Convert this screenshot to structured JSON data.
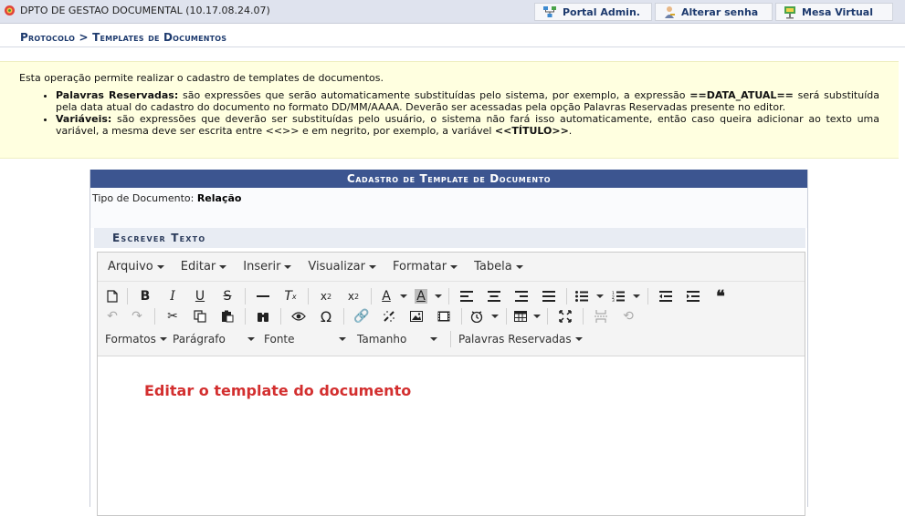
{
  "topbar": {
    "unit": "DPTO DE GESTAO DOCUMENTAL (10.17.08.24.07)",
    "buttons": {
      "portal": "Portal Admin.",
      "senha": "Alterar senha",
      "mesa": "Mesa Virtual"
    }
  },
  "breadcrumb": "Protocolo > Templates de Documentos",
  "info": {
    "intro": "Esta operação permite realizar o cadastro de templates de documentos.",
    "items": [
      {
        "term": "Palavras Reservadas:",
        "text_a": " são expressões que serão automaticamente substituídas pelo sistema, por exemplo, a expressão ",
        "code": "==DATA_ATUAL==",
        "text_b": " será substituída pela data atual do cadastro do documento no formato DD/MM/AAAA. Deverão ser acessadas pela opção Palavras Reservadas presente no editor."
      },
      {
        "term": "Variáveis:",
        "text_a": " são expressões que deverão ser substituídas pelo usuário, o sistema não fará isso automaticamente, então caso queira adicionar ao texto uma variável, a mesma deve ser escrita entre <<>> e em negrito, por exemplo, a variável ",
        "code": "<<TÍTULO>>",
        "text_b": "."
      }
    ]
  },
  "panel": {
    "title": "Cadastro de Template de Documento",
    "tipo_label": "Tipo de Documento:",
    "tipo_value": "Relação",
    "section": "Escrever Texto"
  },
  "editor": {
    "menus": [
      "Arquivo",
      "Editar",
      "Inserir",
      "Visualizar",
      "Formatar",
      "Tabela"
    ],
    "formats": {
      "formatos": "Formatos",
      "paragrafo": "Parágrafo",
      "fonte": "Fonte",
      "tamanho": "Tamanho",
      "palavras": "Palavras Reservadas"
    },
    "content": "Editar o template do documento"
  },
  "colors": {
    "header_blue": "#3c5590",
    "link_blue": "#1d3a6e",
    "info_bg": "#ffffe0",
    "editor_text": "#d32f2f"
  }
}
